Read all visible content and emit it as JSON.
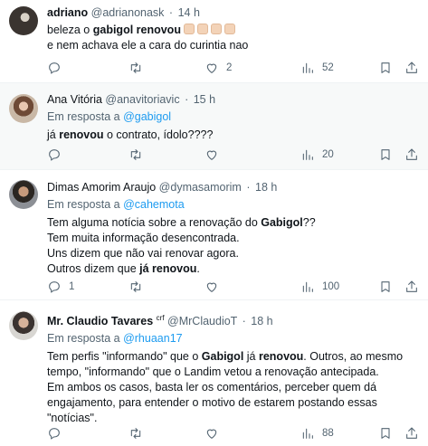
{
  "tweets": [
    {
      "name": "adriano",
      "handle": "@adrianonask",
      "time": "14 h",
      "reply_label": "",
      "reply_to": "",
      "body": [
        {
          "pre": "beleza o ",
          "bold": "gabigol renovou",
          "post": ""
        },
        {
          "pre": "e nem achava ele a cara do curintia nao",
          "bold": "",
          "post": ""
        }
      ],
      "counts": {
        "reply": "",
        "retweet": "",
        "like": "2",
        "views": "52"
      }
    },
    {
      "name": "Ana Vitória",
      "handle": "@anavitoriavic",
      "time": "15 h",
      "reply_label": "Em resposta a",
      "reply_to": "@gabigol",
      "body": [
        {
          "pre": "já ",
          "bold": "renovou",
          "post": " o contrato, ídolo????"
        }
      ],
      "counts": {
        "reply": "",
        "retweet": "",
        "like": "",
        "views": "20"
      }
    },
    {
      "name": "Dimas Amorim Araujo",
      "handle": "@dymasamorim",
      "time": "18 h",
      "reply_label": "Em resposta a",
      "reply_to": "@cahemota",
      "body": [
        {
          "pre": "Tem alguma notícia sobre a renovação do ",
          "bold": "Gabigol",
          "post": "??"
        },
        {
          "pre": "Tem muita informação desencontrada.",
          "bold": "",
          "post": ""
        },
        {
          "pre": "Uns dizem que não vai renovar agora.",
          "bold": "",
          "post": ""
        },
        {
          "pre": "Outros dizem que ",
          "bold": "já renovou",
          "post": "."
        }
      ],
      "counts": {
        "reply": "1",
        "retweet": "",
        "like": "",
        "views": "100"
      }
    },
    {
      "name": "Mr. Claudio Tavares",
      "name_sup": "crf",
      "handle": "@MrClaudioT",
      "time": "18 h",
      "reply_label": "Em resposta a",
      "reply_to": "@rhuaan17",
      "body": [
        {
          "pre": "Tem perfis \"informando\" que o ",
          "bold": "Gabigol",
          "post": " já ",
          "bold2": "renovou",
          "post2": ". Outros, ao mesmo"
        },
        {
          "pre": "tempo, \"informando\" que o Landim vetou a renovação antecipada.",
          "bold": "",
          "post": ""
        },
        {
          "pre": "Em ambos os casos, basta ler os comentários, perceber quem dá",
          "bold": "",
          "post": ""
        },
        {
          "pre": "engajamento, para entender o motivo de estarem postando essas",
          "bold": "",
          "post": ""
        },
        {
          "pre": "\"notícias\".",
          "bold": "",
          "post": ""
        }
      ],
      "counts": {
        "reply": "",
        "retweet": "",
        "like": "",
        "views": "88"
      }
    }
  ],
  "separator": "·",
  "icons": [
    "reply-icon",
    "retweet-icon",
    "like-icon",
    "views-icon",
    "bookmark-icon",
    "share-icon"
  ]
}
